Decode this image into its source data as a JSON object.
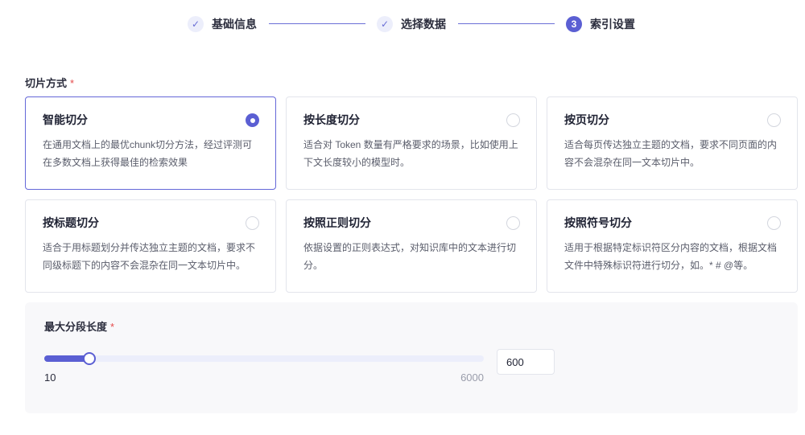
{
  "steps": [
    {
      "label": "基础信息",
      "status": "done",
      "marker": "✓"
    },
    {
      "label": "选择数据",
      "status": "done",
      "marker": "✓"
    },
    {
      "label": "索引设置",
      "status": "active",
      "marker": "3"
    }
  ],
  "chunk_method": {
    "label": "切片方式",
    "required_mark": "*",
    "options": [
      {
        "title": "智能切分",
        "desc": "在通用文档上的最优chunk切分方法，经过评测可在多数文档上获得最佳的检索效果",
        "selected": true
      },
      {
        "title": "按长度切分",
        "desc": "适合对 Token 数量有严格要求的场景，比如使用上下文长度较小的模型时。",
        "selected": false
      },
      {
        "title": "按页切分",
        "desc": "适合每页传达独立主题的文档，要求不同页面的内容不会混杂在同一文本切片中。",
        "selected": false
      },
      {
        "title": "按标题切分",
        "desc": "适合于用标题划分并传达独立主题的文档，要求不同级标题下的内容不会混杂在同一文本切片中。",
        "selected": false
      },
      {
        "title": "按照正则切分",
        "desc": "依据设置的正则表达式，对知识库中的文本进行切分。",
        "selected": false
      },
      {
        "title": "按照符号切分",
        "desc": "适用于根据特定标识符区分内容的文档，根据文档文件中特殊标识符进行切分，如。* # @等。",
        "selected": false
      }
    ]
  },
  "max_segment": {
    "label": "最大分段长度",
    "required_mark": "*",
    "min": "10",
    "max": "6000",
    "value": "600",
    "slider_fraction": 0.098
  },
  "colors": {
    "accent": "#5b5fd3",
    "required": "#e54b4b"
  }
}
